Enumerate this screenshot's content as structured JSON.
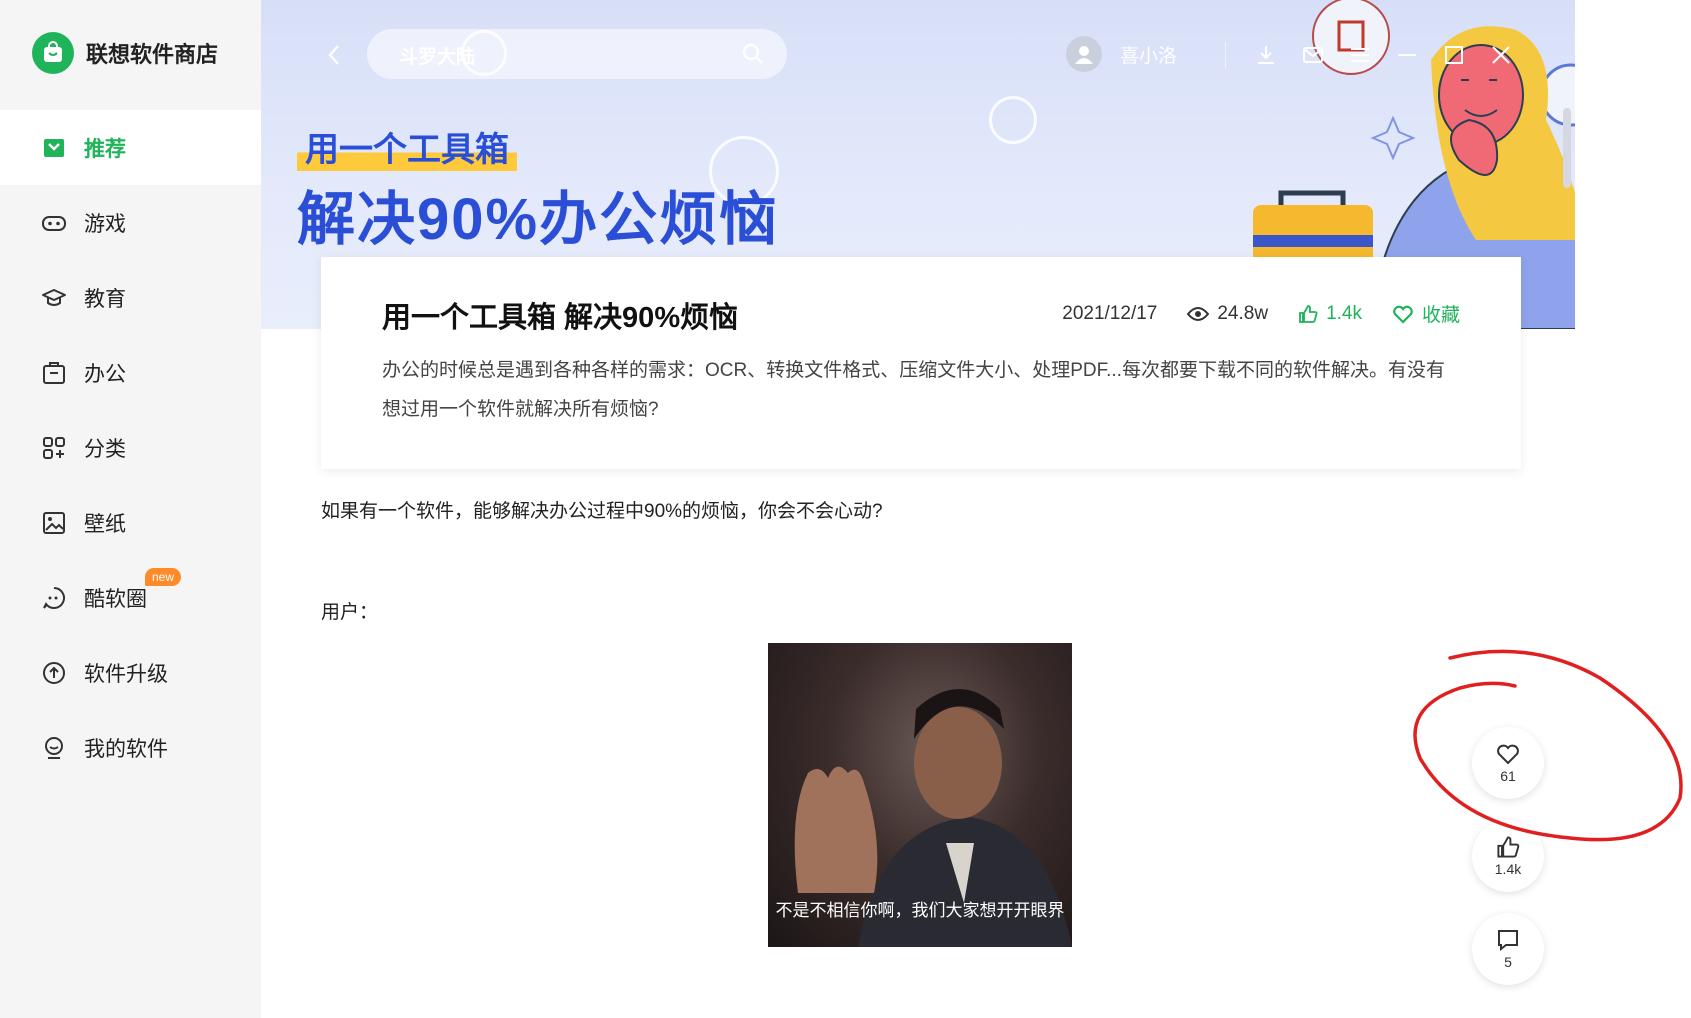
{
  "app": {
    "name": "联想软件商店"
  },
  "sidebar": {
    "items": [
      {
        "label": "推荐",
        "icon": "recommend-icon",
        "active": true
      },
      {
        "label": "游戏",
        "icon": "gamepad-icon"
      },
      {
        "label": "教育",
        "icon": "graduation-cap-icon"
      },
      {
        "label": "办公",
        "icon": "briefcase-icon"
      },
      {
        "label": "分类",
        "icon": "category-grid-icon"
      },
      {
        "label": "壁纸",
        "icon": "wallpaper-icon"
      },
      {
        "label": "酷软圈",
        "icon": "community-icon",
        "badge": "new"
      },
      {
        "label": "软件升级",
        "icon": "upgrade-icon"
      },
      {
        "label": "我的软件",
        "icon": "my-software-icon"
      }
    ]
  },
  "header": {
    "search": {
      "value": "斗罗大陆"
    },
    "user": {
      "name": "喜小洛"
    }
  },
  "banner": {
    "line1": "用一个工具箱",
    "line2": "解决90%办公烦恼"
  },
  "article": {
    "title": "用一个工具箱 解决90%烦恼",
    "date": "2021/12/17",
    "views": "24.8w",
    "likes": "1.4k",
    "favorite_label": "收藏",
    "description": "办公的时候总是遇到各种各样的需求：OCR、转换文件格式、压缩文件大小、处理PDF...每次都要下载不同的软件解决。有没有想过用一个软件就解决所有烦恼?",
    "para1": "如果有一个软件，能够解决办公过程中90%的烦恼，你会不会心动?",
    "para2": "用户：",
    "gif_caption": "不是不相信你啊，我们大家想开开眼界"
  },
  "actions": {
    "favorite_count": "61",
    "like_count": "1.4k",
    "comment_count": "5"
  },
  "colors": {
    "brand_green": "#1fb35a",
    "banner_blue": "#2a4fd6",
    "highlight_yellow": "#ffc93c",
    "annotation_red": "#e02020"
  }
}
